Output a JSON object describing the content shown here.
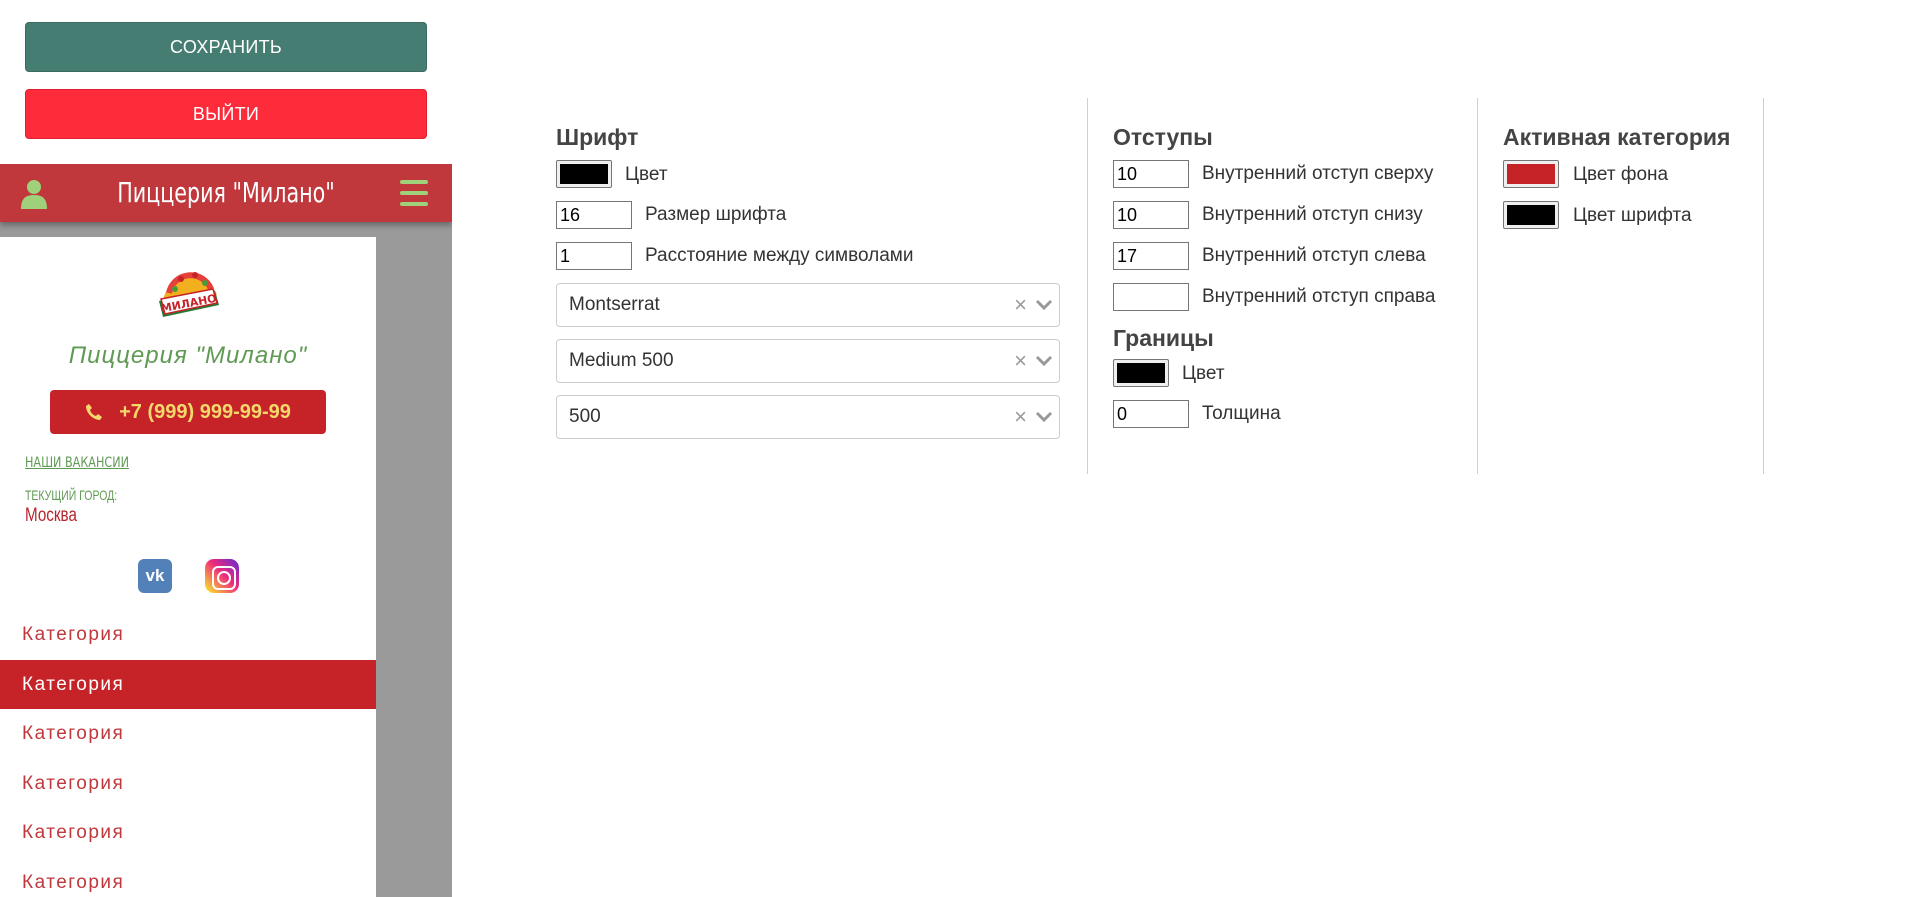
{
  "toolbar": {
    "save_label": "СОХРАНИТЬ",
    "exit_label": "ВЫЙТИ"
  },
  "preview": {
    "header_title": "Пиццерия \"Милано\"",
    "logo_text": "МИЛАНО",
    "brand_name": "Пиццерия \"Милано\"",
    "phone": "+7 (999) 999-99-99",
    "vacancies_link": "НАШИ ВАКАНСИИ",
    "city_label": "ТЕКУЩИЙ ГОРОД:",
    "city": "Москва",
    "social": [
      "vk-icon",
      "instagram-icon"
    ],
    "categories": [
      {
        "label": "Категория",
        "active": false
      },
      {
        "label": "Категория",
        "active": true
      },
      {
        "label": "Категория",
        "active": false
      },
      {
        "label": "Категория",
        "active": false
      },
      {
        "label": "Категория",
        "active": false
      },
      {
        "label": "Категория",
        "active": false
      }
    ],
    "colors": {
      "header": "#c0373c",
      "accent": "#c62329",
      "green": "#5f9a53",
      "phone_text": "#f3d96b"
    }
  },
  "font": {
    "title": "Шрифт",
    "color_label": "Цвет",
    "color_value": "#000000",
    "size_value": "16",
    "size_label": "Размер шрифта",
    "spacing_value": "1",
    "spacing_label": "Расстояние между символами",
    "family_value": "Montserrat",
    "style_value": "Medium 500",
    "weight_value": "500"
  },
  "padding": {
    "title": "Отступы",
    "top_value": "10",
    "top_label": "Внутренний отступ сверху",
    "bottom_value": "10",
    "bottom_label": "Внутренний отступ снизу",
    "left_value": "17",
    "left_label": "Внутренний отступ слева",
    "right_value": "",
    "right_label": "Внутренний отступ справа"
  },
  "borders": {
    "title": "Границы",
    "color_label": "Цвет",
    "color_value": "#000000",
    "width_value": "0",
    "width_label": "Толщина"
  },
  "active_category": {
    "title": "Активная категория",
    "bg_label": "Цвет фона",
    "bg_value": "#c62329",
    "font_label": "Цвет шрифта",
    "font_value": "#000000"
  }
}
